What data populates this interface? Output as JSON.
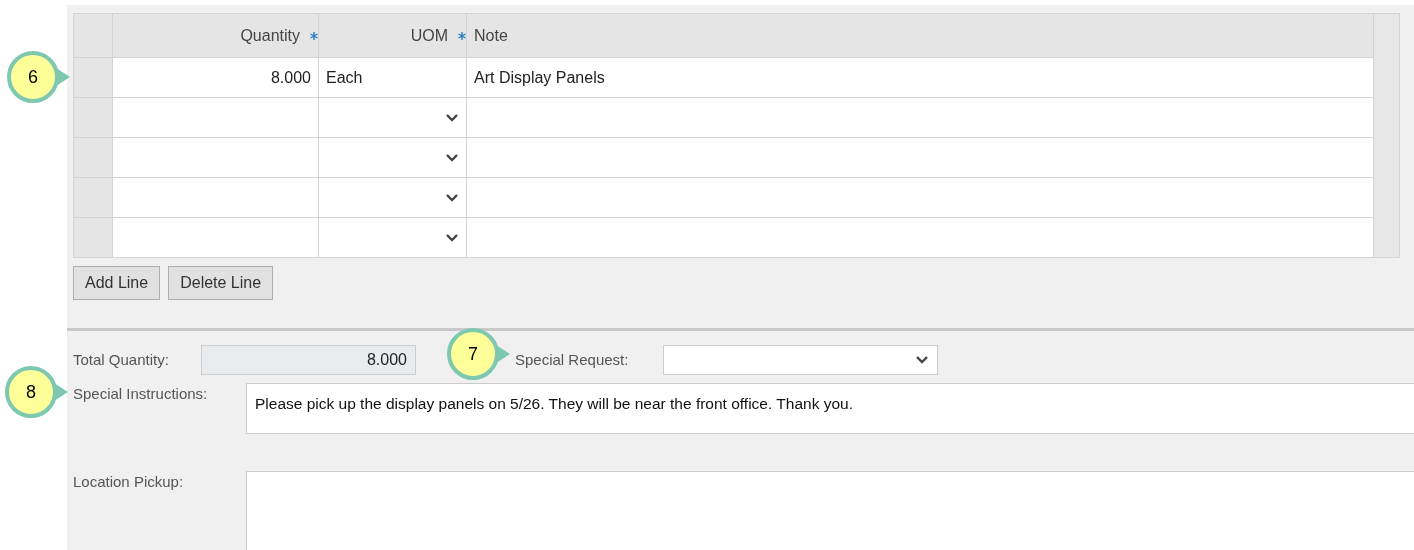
{
  "table": {
    "columns": [
      {
        "label": "Quantity",
        "required": true
      },
      {
        "label": "UOM",
        "required": true
      },
      {
        "label": "Note",
        "required": false
      }
    ],
    "rows": [
      {
        "kind": "filled",
        "quantity": "8.000",
        "uom": "Each",
        "note": "Art Display Panels"
      },
      {
        "kind": "empty"
      },
      {
        "kind": "empty"
      },
      {
        "kind": "empty"
      },
      {
        "kind": "empty"
      }
    ]
  },
  "buttons": [
    "Add Line",
    "Delete Line"
  ],
  "total_quantity": {
    "label": "Total Quantity:",
    "value": "8.000"
  },
  "special_request": {
    "label": "Special Request:"
  },
  "special_instructions": {
    "label": "Special Instructions:",
    "value": "Please pick up the display panels on 5/26. They will be near the front office. Thank you."
  },
  "location_pickup": {
    "label": "Location Pickup:"
  },
  "callouts": [
    {
      "number": "6"
    },
    {
      "number": "7"
    },
    {
      "number": "8"
    }
  ]
}
